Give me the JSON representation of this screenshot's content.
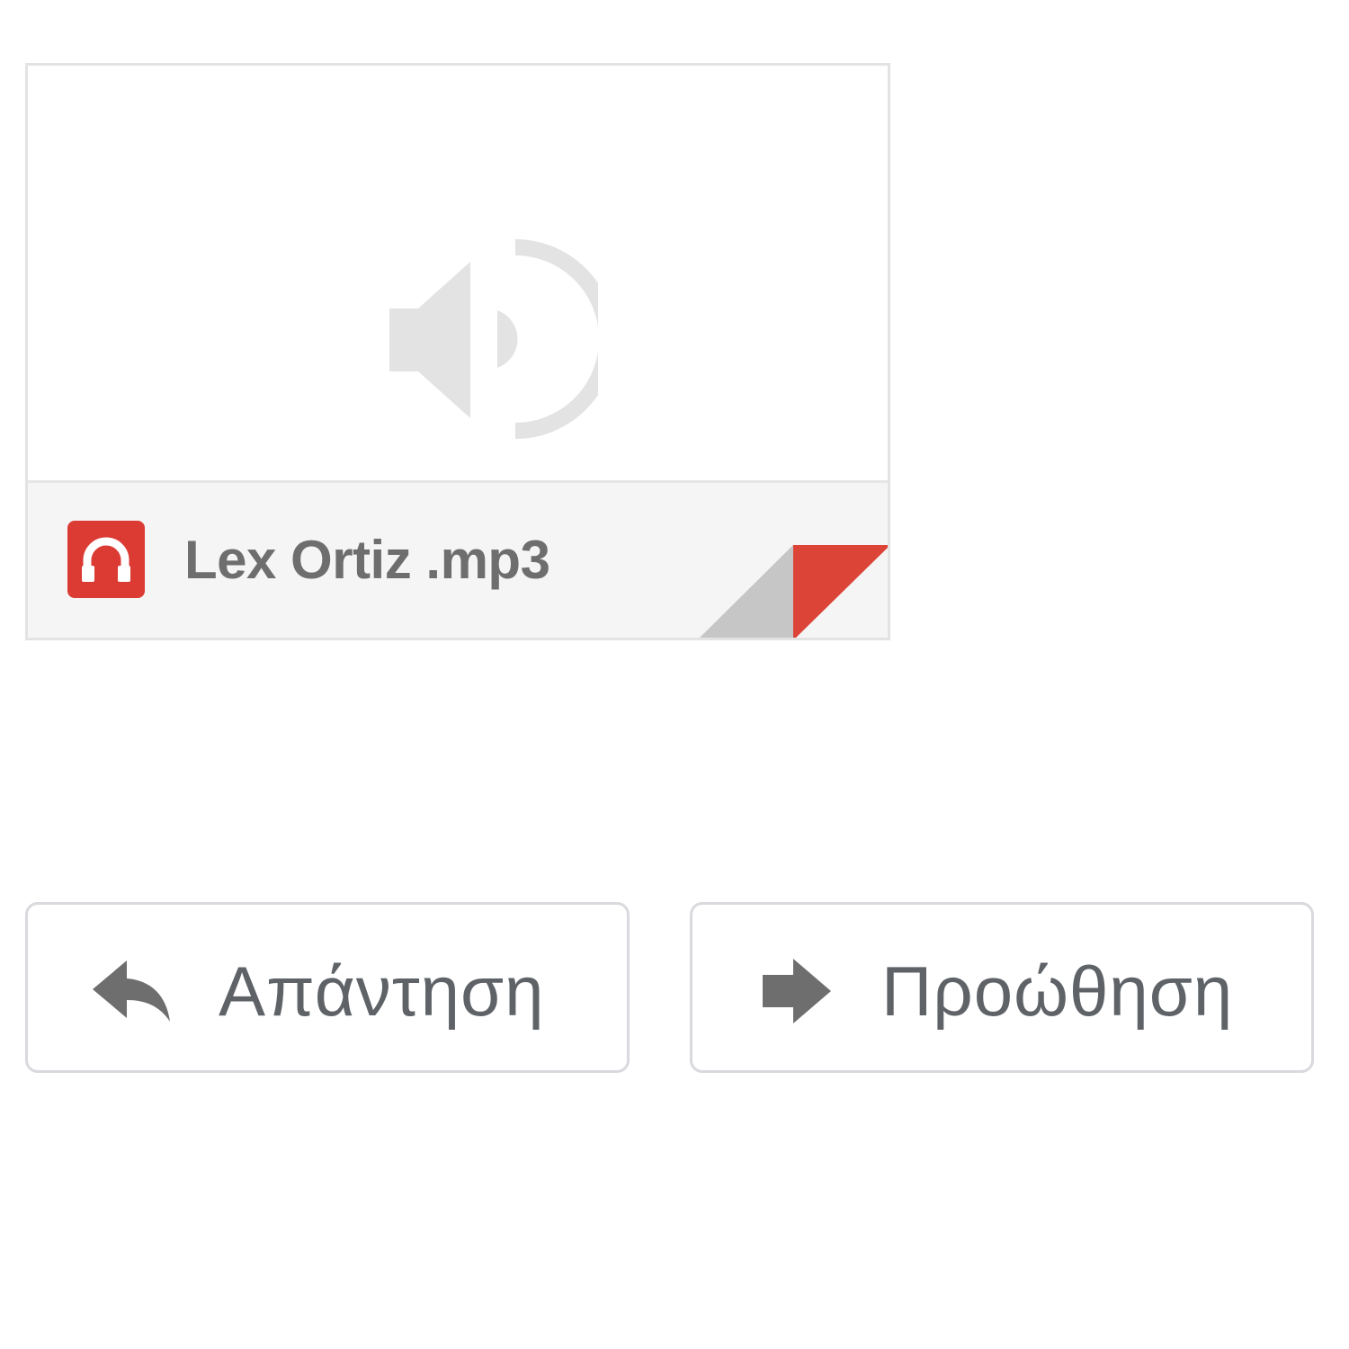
{
  "attachment": {
    "file_name": "Lex Ortiz .mp3",
    "preview_icon": "speaker-icon",
    "file_type_icon": "headphones-icon",
    "accent_color": "#db3b33"
  },
  "actions": {
    "reply_label": "Απάντηση",
    "reply_icon": "reply-arrow-icon",
    "forward_label": "Προώθηση",
    "forward_icon": "forward-arrow-icon"
  }
}
